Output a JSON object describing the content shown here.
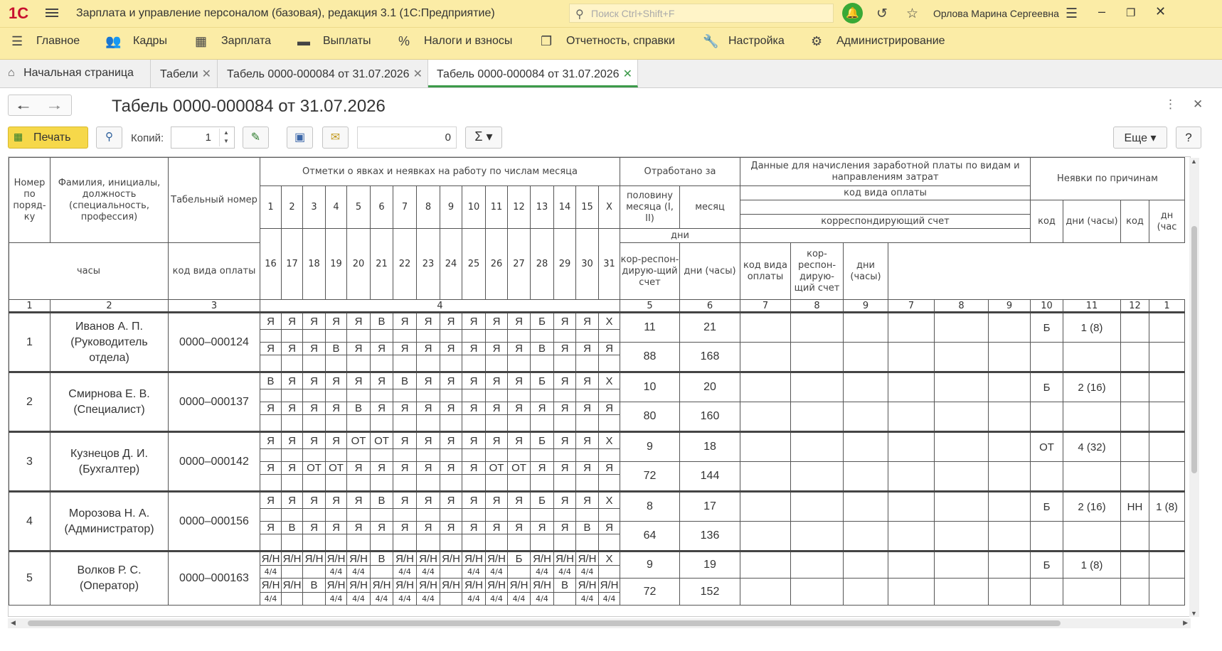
{
  "app": {
    "logo": "1С",
    "title": "Зарплата и управление персоналом (базовая), редакция 3.1  (1С:Предприятие)",
    "search_placeholder": "Поиск Ctrl+Shift+F",
    "user": "Орлова Марина Сергеевна"
  },
  "menu": {
    "items": [
      {
        "label": "Главное",
        "icon": "menu-lines-icon"
      },
      {
        "label": "Кадры",
        "icon": "people-icon"
      },
      {
        "label": "Зарплата",
        "icon": "calculator-icon"
      },
      {
        "label": "Выплаты",
        "icon": "card-icon"
      },
      {
        "label": "Налоги и взносы",
        "icon": "percent-icon"
      },
      {
        "label": "Отчетность, справки",
        "icon": "documents-icon"
      },
      {
        "label": "Настройка",
        "icon": "wrench-icon"
      },
      {
        "label": "Администрирование",
        "icon": "gear-icon"
      }
    ]
  },
  "tabs": [
    {
      "label": "Начальная страница"
    },
    {
      "label": "Табели"
    },
    {
      "label": "Табель 0000-000084 от 31.07.2026"
    },
    {
      "label": "Табель 0000-000084 от 31.07.2026"
    }
  ],
  "doc": {
    "title": "Табель 0000-000084 от 31.07.2026"
  },
  "toolbar": {
    "print_label": "Печать",
    "copies_label": "Копий:",
    "copies_value": "1",
    "sum_value": "0",
    "sigma_label": "Σ ▾",
    "more_label": "Еще ▾",
    "help_label": "?"
  },
  "colors": {
    "accent": "#fbeca6",
    "active_tab": "#3c9a4a",
    "print_button": "#f6d84a"
  },
  "report": {
    "headers": {
      "num": "Номер по поряд-ку",
      "name": "Фамилия, инициалы, должность (специальность, профессия)",
      "tab_num": "Табельный номер",
      "marks": "Отметки о явках и неявках на работу по числам месяца",
      "worked": "Отработано за",
      "half": "половину месяца (I, II)",
      "month": "месяц",
      "days": "дни",
      "hours": "часы",
      "pay_data": "Данные для начисления заработной платы по видам и направлениям затрат",
      "pay_code": "код вида оплаты",
      "corr_account": "корреспондирующий счет",
      "code_pay": "код вида оплаты",
      "corr": "кор-респон-дирую-щий счет",
      "days_hours": "дни (часы)",
      "absence": "Неявки по причинам",
      "code": "код",
      "abs_days_hours": "дни (часы)",
      "code2": "код",
      "dh2": "дн (час"
    },
    "days_first": [
      "1",
      "2",
      "3",
      "4",
      "5",
      "6",
      "7",
      "8",
      "9",
      "10",
      "11",
      "12",
      "13",
      "14",
      "15",
      "X"
    ],
    "days_second": [
      "16",
      "17",
      "18",
      "19",
      "20",
      "21",
      "22",
      "23",
      "24",
      "25",
      "26",
      "27",
      "28",
      "29",
      "30",
      "31"
    ],
    "col_numbers": [
      "1",
      "2",
      "3",
      "4",
      "5",
      "6",
      "7",
      "8",
      "9",
      "7",
      "8",
      "9",
      "10",
      "11",
      "12",
      "1"
    ],
    "employees": [
      {
        "num": "1",
        "name": "Иванов А. П. (Руководитель отдела)",
        "tab": "0000–000124",
        "marks1": [
          "Я",
          "Я",
          "Я",
          "Я",
          "Я",
          "В",
          "Я",
          "Я",
          "Я",
          "Я",
          "Я",
          "Я",
          "Б",
          "Я",
          "Я",
          "Х"
        ],
        "marks2": [
          "Я",
          "Я",
          "Я",
          "В",
          "Я",
          "Я",
          "Я",
          "Я",
          "Я",
          "Я",
          "Я",
          "Я",
          "В",
          "Я",
          "Я",
          "Я"
        ],
        "half_days": "11",
        "month_days": "21",
        "half_hours": "88",
        "month_hours": "168",
        "abs_code": "Б",
        "abs_days": "1 (8)",
        "abs_code2": "",
        "abs_days2": ""
      },
      {
        "num": "2",
        "name": "Смирнова Е. В. (Специалист)",
        "tab": "0000–000137",
        "marks1": [
          "В",
          "Я",
          "Я",
          "Я",
          "Я",
          "Я",
          "В",
          "Я",
          "Я",
          "Я",
          "Я",
          "Я",
          "Б",
          "Я",
          "Я",
          "Х"
        ],
        "marks2": [
          "Я",
          "Я",
          "Я",
          "Я",
          "В",
          "Я",
          "Я",
          "Я",
          "Я",
          "Я",
          "Я",
          "Я",
          "Я",
          "Я",
          "Я",
          "Я"
        ],
        "half_days": "10",
        "month_days": "20",
        "half_hours": "80",
        "month_hours": "160",
        "abs_code": "Б",
        "abs_days": "2 (16)",
        "abs_code2": "",
        "abs_days2": ""
      },
      {
        "num": "3",
        "name": "Кузнецов Д. И. (Бухгалтер)",
        "tab": "0000–000142",
        "marks1": [
          "Я",
          "Я",
          "Я",
          "Я",
          "ОТ",
          "ОТ",
          "Я",
          "Я",
          "Я",
          "Я",
          "Я",
          "Я",
          "Б",
          "Я",
          "Я",
          "Х"
        ],
        "marks2": [
          "Я",
          "Я",
          "ОТ",
          "ОТ",
          "Я",
          "Я",
          "Я",
          "Я",
          "Я",
          "Я",
          "ОТ",
          "ОТ",
          "Я",
          "Я",
          "Я",
          "Я"
        ],
        "half_days": "9",
        "month_days": "18",
        "half_hours": "72",
        "month_hours": "144",
        "abs_code": "ОТ",
        "abs_days": "4 (32)",
        "abs_code2": "",
        "abs_days2": ""
      },
      {
        "num": "4",
        "name": "Морозова Н. А. (Администратор)",
        "tab": "0000–000156",
        "marks1": [
          "Я",
          "Я",
          "Я",
          "Я",
          "Я",
          "В",
          "Я",
          "Я",
          "Я",
          "Я",
          "Я",
          "Я",
          "Б",
          "Я",
          "Я",
          "Х"
        ],
        "marks2": [
          "Я",
          "В",
          "Я",
          "Я",
          "Я",
          "Я",
          "Я",
          "Я",
          "Я",
          "Я",
          "Я",
          "Я",
          "Я",
          "Я",
          "В",
          "Я"
        ],
        "half_days": "8",
        "month_days": "17",
        "half_hours": "64",
        "month_hours": "136",
        "abs_code": "Б",
        "abs_days": "2 (16)",
        "abs_code2": "НН",
        "abs_days2": "1 (8)"
      },
      {
        "num": "5",
        "name": "Волков Р. С. (Оператор)",
        "tab": "0000–000163",
        "marks1": [
          "Я/Н",
          "Я/Н",
          "Я/Н",
          "Я/Н",
          "Я/Н",
          "В",
          "Я/Н",
          "Я/Н",
          "Я/Н",
          "Я/Н",
          "Я/Н",
          "Б",
          "Я/Н",
          "Я/Н",
          "Я/Н",
          "Х"
        ],
        "hours1": [
          "4/4",
          "",
          "",
          "4/4",
          "4/4",
          "",
          "4/4",
          "4/4",
          "",
          "4/4",
          "4/4",
          "",
          "4/4",
          "4/4",
          "4/4",
          ""
        ],
        "marks2": [
          "Я/Н",
          "Я/Н",
          "В",
          "Я/Н",
          "Я/Н",
          "Я/Н",
          "Я/Н",
          "Я/Н",
          "Я/Н",
          "Я/Н",
          "Я/Н",
          "Я/Н",
          "Я/Н",
          "В",
          "Я/Н",
          "Я/Н"
        ],
        "hours2": [
          "4/4",
          "",
          "",
          "4/4",
          "4/4",
          "4/4",
          "4/4",
          "4/4",
          "",
          "4/4",
          "4/4",
          "4/4",
          "4/4",
          "",
          "4/4",
          "4/4"
        ],
        "half_days": "9",
        "month_days": "19",
        "half_hours": "72",
        "month_hours": "152",
        "abs_code": "Б",
        "abs_days": "1 (8)",
        "abs_code2": "",
        "abs_days2": ""
      }
    ]
  }
}
